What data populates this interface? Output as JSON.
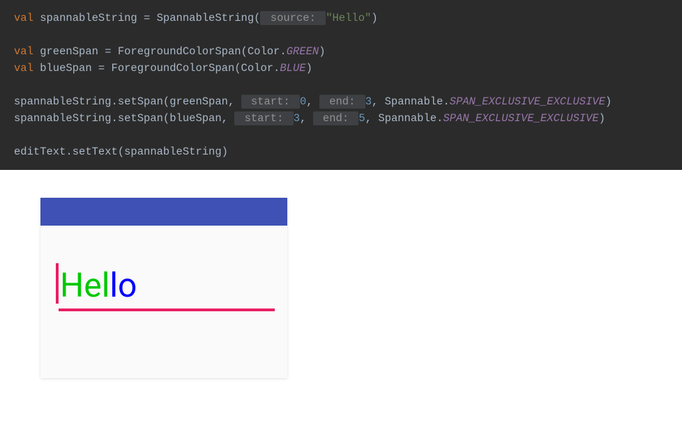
{
  "code": {
    "l1": {
      "kw": "val",
      "var": " spannableString = SpannableString(",
      "hint": " source: ",
      "str": "\"Hello\"",
      "end": ")"
    },
    "l3": {
      "kw": "val",
      "var": " greenSpan = ForegroundColorSpan(Color.",
      "const": "GREEN",
      "end": ")"
    },
    "l4": {
      "kw": "val",
      "var": " blueSpan = ForegroundColorSpan(Color.",
      "const": "BLUE",
      "end": ")"
    },
    "l6": {
      "pre": "spannableString.setSpan(greenSpan, ",
      "h1": " start: ",
      "n1": "0",
      "mid1": ", ",
      "h2": " end: ",
      "n2": "3",
      "mid2": ", Spannable.",
      "const": "SPAN_EXCLUSIVE_EXCLUSIVE",
      "end": ")"
    },
    "l7": {
      "pre": "spannableString.setSpan(blueSpan, ",
      "h1": " start: ",
      "n1": "3",
      "mid1": ", ",
      "h2": " end: ",
      "n2": "5",
      "mid2": ", Spannable.",
      "const": "SPAN_EXCLUSIVE_EXCLUSIVE",
      "end": ")"
    },
    "l9": {
      "text": "editText.setText(spannableString)"
    }
  },
  "preview": {
    "text_green": "Hel",
    "text_blue": "lo"
  }
}
